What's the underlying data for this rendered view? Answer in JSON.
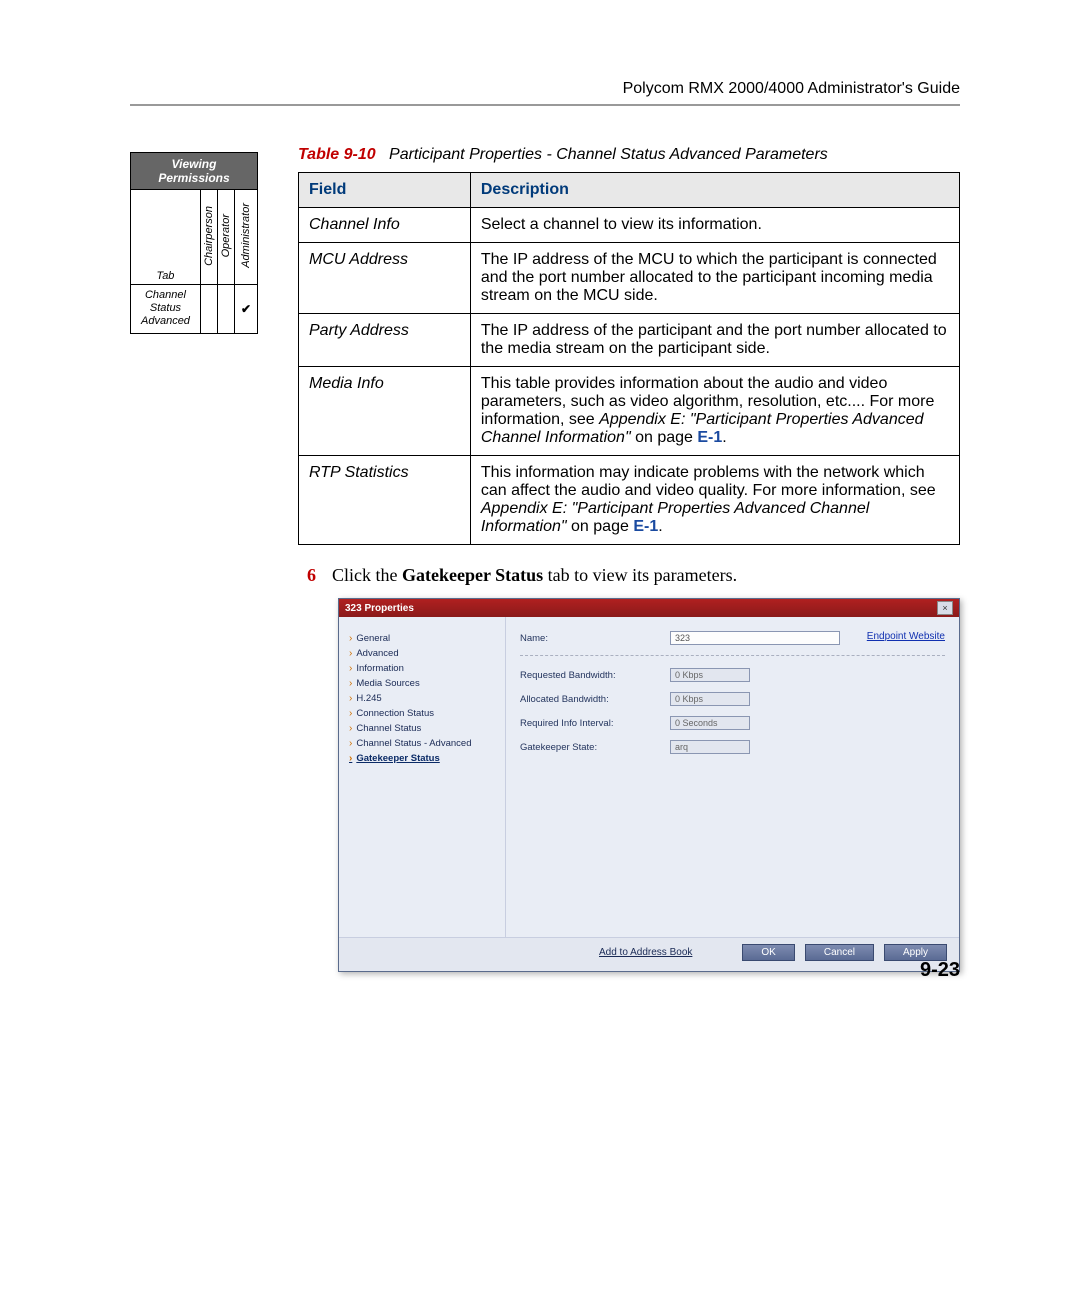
{
  "header": {
    "title": "Polycom RMX 2000/4000 Administrator's Guide"
  },
  "perm_table": {
    "title": "Viewing Permissions",
    "tab_label": "Tab",
    "cols": [
      "Chairperson",
      "Operator",
      "Administrator"
    ],
    "row_label": "Channel Status Advanced",
    "marks": [
      "",
      "",
      "✔"
    ]
  },
  "main_table": {
    "caption_tag": "Table 9-10",
    "caption_rest": "Participant Properties - Channel Status Advanced Parameters",
    "head_field": "Field",
    "head_desc": "Description",
    "rows": [
      {
        "field": "Channel Info",
        "desc_plain": "Select a channel to view its information."
      },
      {
        "field": "MCU Address",
        "desc_plain": "The IP address of the MCU to which the participant is connected and the port number allocated to the participant incoming media stream on the MCU side."
      },
      {
        "field": "Party Address",
        "desc_plain": "The IP address of the participant and the port number allocated to the media stream on the participant side."
      },
      {
        "field": "Media Info",
        "desc_pre": "This table provides information about the audio and video parameters, such as video algorithm, resolution, etc.... For more information, see ",
        "desc_italic": "Appendix E: \"Participant Properties Advanced Channel Information\"",
        "desc_mid": " on page ",
        "desc_link": "E-1",
        "desc_post": "."
      },
      {
        "field": "RTP Statistics",
        "desc_pre": "This information may indicate problems with the network which can affect the audio and video quality. For more information, see ",
        "desc_italic": "Appendix E: \"Participant Properties Advanced Channel Information\"",
        "desc_mid": " on page ",
        "desc_link": "E-1",
        "desc_post": "."
      }
    ]
  },
  "step6": {
    "num": "6",
    "pre": "Click the ",
    "bold": "Gatekeeper Status",
    "post": " tab to view its parameters."
  },
  "dialog": {
    "title": "323 Properties",
    "close": "×",
    "side_items": [
      "General",
      "Advanced",
      "Information",
      "Media Sources",
      "H.245",
      "Connection Status",
      "Channel Status",
      "Channel Status - Advanced",
      "Gatekeeper Status"
    ],
    "side_selected_index": 8,
    "endpoint_link": "Endpoint Website",
    "fields": {
      "name_lbl": "Name:",
      "name_val": "323",
      "req_bw_lbl": "Requested Bandwidth:",
      "req_bw_val": "0  Kbps",
      "alloc_bw_lbl": "Allocated Bandwidth:",
      "alloc_bw_val": "0  Kbps",
      "req_int_lbl": "Required Info Interval:",
      "req_int_val": "0  Seconds",
      "gk_state_lbl": "Gatekeeper State:",
      "gk_state_val": "arq"
    },
    "footer": {
      "addr": "Add to Address Book",
      "ok": "OK",
      "cancel": "Cancel",
      "apply": "Apply"
    }
  },
  "page_number": "9-23"
}
